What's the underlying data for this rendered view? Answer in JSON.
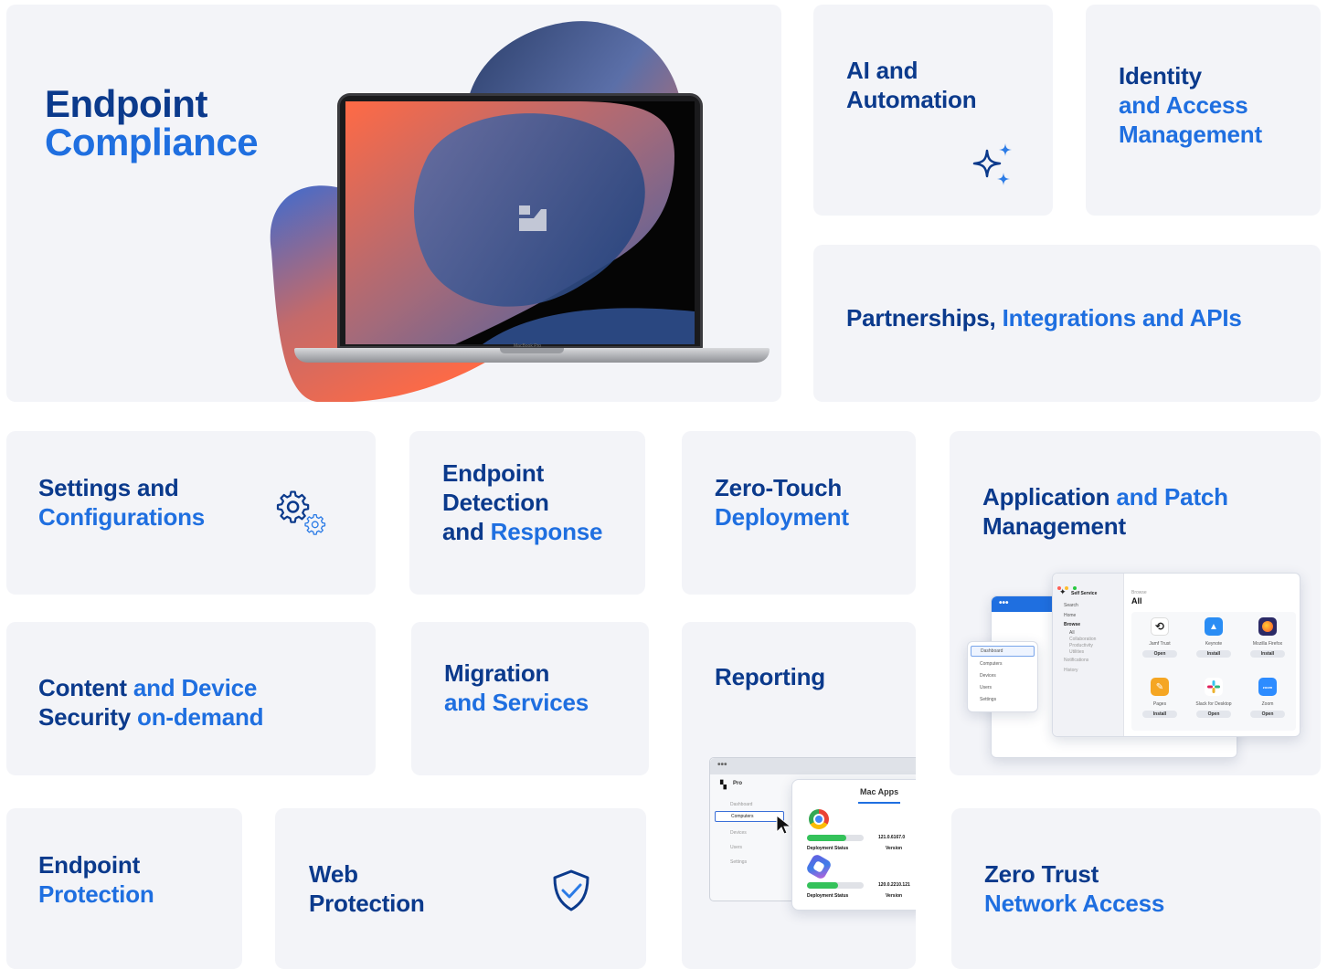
{
  "endpoint_compliance": {
    "line1": "Endpoint",
    "line2": "Compliance"
  },
  "laptop": {
    "model_label": "MacBook Pro"
  },
  "ai_automation": {
    "line1": "AI and",
    "line2": "Automation"
  },
  "identity": {
    "line1": "Identity",
    "line2": "and Access",
    "line3": "Management"
  },
  "partnerships": {
    "part1": "Partnerships, ",
    "part2": "Integrations and APIs"
  },
  "settings": {
    "line1": "Settings and",
    "line2": "Configurations"
  },
  "edr": {
    "line1": "Endpoint",
    "line2": "Detection",
    "line3a": "and ",
    "line3b": "Response"
  },
  "zero_touch": {
    "line1": "Zero-Touch",
    "line2": "Deployment"
  },
  "app_patch": {
    "line1a": "Application ",
    "line1b": "and Patch",
    "line2": "Management"
  },
  "content_security": {
    "line1a": "Content ",
    "line1b": "and Device",
    "line2a": "Security ",
    "line2b": "on-demand"
  },
  "migration": {
    "line1": "Migration",
    "line2": "and Services"
  },
  "reporting": {
    "title": "Reporting"
  },
  "endpoint_protection": {
    "line1": "Endpoint",
    "line2": "Protection"
  },
  "web_protection": {
    "line1": "Web",
    "line2": "Protection"
  },
  "ztna": {
    "line1": "Zero Trust",
    "line2": "Network Access"
  },
  "self_service": {
    "app_title": "Self Service",
    "search": "Search",
    "nav": [
      "Home",
      "Browse",
      "All",
      "Collaboration",
      "Productivity",
      "Utilities",
      "Notifications",
      "History"
    ],
    "browse_label": "Browse",
    "section_title": "All",
    "apps": [
      {
        "name": "Jamf Trust",
        "action": "Open",
        "color": "#ffffff"
      },
      {
        "name": "Keynote",
        "action": "Install",
        "color": "#2a8df4"
      },
      {
        "name": "Mozilla Firefox",
        "action": "Install",
        "color": "#2b2a66"
      },
      {
        "name": "Pages",
        "action": "Install",
        "color": "#f5a623"
      },
      {
        "name": "Slack for Desktop",
        "action": "Open",
        "color": "#ffffff"
      },
      {
        "name": "Zoom",
        "action": "Open",
        "color": "#2d8cff"
      }
    ],
    "admin_nav": [
      "Dashboard",
      "Computers",
      "Devices",
      "Users",
      "Settings"
    ]
  },
  "reporting_window": {
    "brand": "Pro",
    "nav": [
      "Dashboard",
      "Computers",
      "Devices",
      "Users",
      "Settings"
    ],
    "card_title": "Mac Apps",
    "rows": [
      {
        "status_label": "Deployment Status",
        "version": "121.0.6167.0",
        "version_label": "Version",
        "progress": 0.7
      },
      {
        "status_label": "Deployment Status",
        "version": "120.0.2210.121",
        "version_label": "Version",
        "progress": 0.55
      }
    ]
  },
  "colors": {
    "dark_blue": "#0b3a8c",
    "bright_blue": "#1f6fe0",
    "tile_bg": "#f3f4f8",
    "accent_orange": "#ff6a45"
  }
}
